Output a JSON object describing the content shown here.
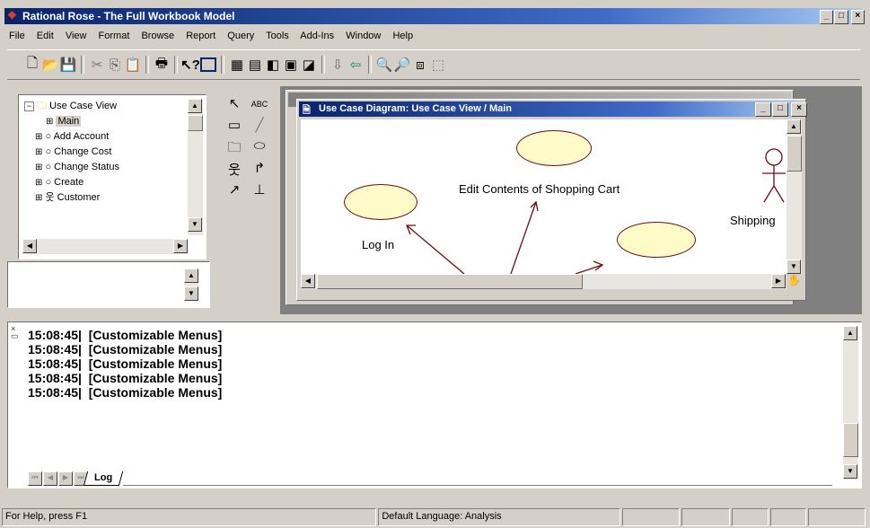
{
  "window": {
    "title": "Rational Rose - The Full Workbook Model"
  },
  "menu": [
    "File",
    "Edit",
    "View",
    "Format",
    "Browse",
    "Report",
    "Query",
    "Tools",
    "Add-Ins",
    "Window",
    "Help"
  ],
  "toolbar": [
    "new-icon",
    "open-icon",
    "save-icon",
    "cut-icon",
    "copy-icon",
    "paste-icon",
    "print-icon",
    "context-help-icon",
    "view-doc-icon",
    "browse-class-icon",
    "browse-interaction-icon",
    "browse-component-icon",
    "browse-deployment-icon",
    "browse-parent-icon",
    "previous-diagram-icon",
    "back-arrow-icon",
    "zoom-in-icon",
    "zoom-out-icon",
    "fit-window-icon",
    "undo-fit-icon"
  ],
  "browser": {
    "root": "Use Case View",
    "items": [
      {
        "label": "Main",
        "icon": "diagram-icon"
      },
      {
        "label": "Add Account",
        "icon": "usecase-icon"
      },
      {
        "label": "Change Cost",
        "icon": "usecase-icon"
      },
      {
        "label": "Change Status",
        "icon": "usecase-icon"
      },
      {
        "label": "Create",
        "icon": "usecase-icon"
      },
      {
        "label": "Customer",
        "icon": "actor-icon"
      }
    ]
  },
  "toolbox": [
    "selection-arrow-icon",
    "text-box-icon",
    "note-icon",
    "anchor-line-icon",
    "package-icon",
    "use-case-icon",
    "actor-icon",
    "unidirectional-assoc-icon",
    "dependency-icon",
    "generalization-icon"
  ],
  "toolbox_text": {
    "text_tool": "ABC"
  },
  "diagram": {
    "title": "Use Case Diagram: Use Case View / Main",
    "labels": {
      "edit_cart": "Edit Contents of Shopping Cart",
      "login": "Log In",
      "shipping": "Shipping"
    },
    "colors": {
      "usecase_fill": "#fffbc8",
      "usecase_stroke": "#6e0e14"
    }
  },
  "log": {
    "lines": [
      {
        "time": "15:08:45|",
        "msg": "[Customizable Menus]"
      },
      {
        "time": "15:08:45|",
        "msg": "[Customizable Menus]"
      },
      {
        "time": "15:08:45|",
        "msg": "[Customizable Menus]"
      },
      {
        "time": "15:08:45|",
        "msg": "[Customizable Menus]"
      },
      {
        "time": "15:08:45|",
        "msg": "[Customizable Menus]"
      }
    ],
    "tab": "Log"
  },
  "status": {
    "help": "For Help, press F1",
    "language": "Default Language: Analysis"
  }
}
